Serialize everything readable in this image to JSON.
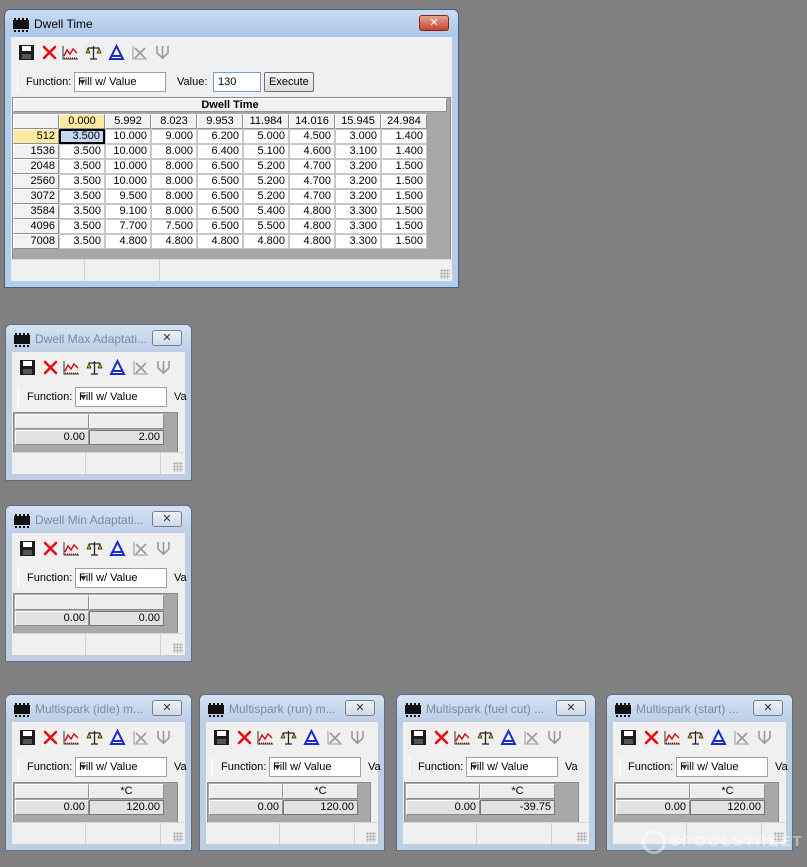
{
  "function_label": "Function:",
  "function_value": "Fill w/ Value",
  "value_label": "Value:",
  "value_label_short": "Va",
  "close_glyph": "✕",
  "toolbar_icons": [
    "save-icon",
    "delete-icon",
    "graph-icon",
    "balance-icon",
    "interpolate-icon",
    "smooth-icon",
    "scale-icon"
  ],
  "dwell_time": {
    "title": "Dwell Time",
    "value": "130",
    "execute_label": "Execute",
    "table_title": "Dwell Time",
    "columns": [
      "0.000",
      "5.992",
      "8.023",
      "9.953",
      "11.984",
      "14.016",
      "15.945",
      "24.984"
    ],
    "rows": [
      {
        "rpm": "512",
        "values": [
          "3.500",
          "10.000",
          "9.000",
          "6.200",
          "5.000",
          "4.500",
          "3.000",
          "1.400"
        ]
      },
      {
        "rpm": "1536",
        "values": [
          "3.500",
          "10.000",
          "8.000",
          "6.400",
          "5.100",
          "4.600",
          "3.100",
          "1.400"
        ]
      },
      {
        "rpm": "2048",
        "values": [
          "3.500",
          "10.000",
          "8.000",
          "6.500",
          "5.200",
          "4.700",
          "3.200",
          "1.500"
        ]
      },
      {
        "rpm": "2560",
        "values": [
          "3.500",
          "10.000",
          "8.000",
          "6.500",
          "5.200",
          "4.700",
          "3.200",
          "1.500"
        ]
      },
      {
        "rpm": "3072",
        "values": [
          "3.500",
          "9.500",
          "8.000",
          "6.500",
          "5.200",
          "4.700",
          "3.200",
          "1.500"
        ]
      },
      {
        "rpm": "3584",
        "values": [
          "3.500",
          "9.100",
          "8.000",
          "6.500",
          "5.400",
          "4.800",
          "3.300",
          "1.500"
        ]
      },
      {
        "rpm": "4096",
        "values": [
          "3.500",
          "7.700",
          "7.500",
          "6.500",
          "5.500",
          "4.800",
          "3.300",
          "1.500"
        ]
      },
      {
        "rpm": "7008",
        "values": [
          "3.500",
          "4.800",
          "4.800",
          "4.800",
          "4.800",
          "4.800",
          "3.300",
          "1.500"
        ]
      }
    ]
  },
  "dwell_max": {
    "title": "Dwell Max Adaptati...",
    "header": "",
    "label": "0.00",
    "value": "2.00"
  },
  "dwell_min": {
    "title": "Dwell Min Adaptati...",
    "header": "",
    "label": "0.00",
    "value": "0.00"
  },
  "ms_idle": {
    "title": "Multispark (idle) m...",
    "header": "*C",
    "label": "0.00",
    "value": "120.00"
  },
  "ms_run": {
    "title": "Multispark (run) m...",
    "header": "*C",
    "label": "0.00",
    "value": "120.00"
  },
  "ms_fuel": {
    "title": "Multispark (fuel cut) ...",
    "header": "*C",
    "label": "0.00",
    "value": "-39.75"
  },
  "ms_start": {
    "title": "Multispark (start) ...",
    "header": "*C",
    "label": "0.00",
    "value": "120.00"
  },
  "watermark": "SPOOLSTREET"
}
